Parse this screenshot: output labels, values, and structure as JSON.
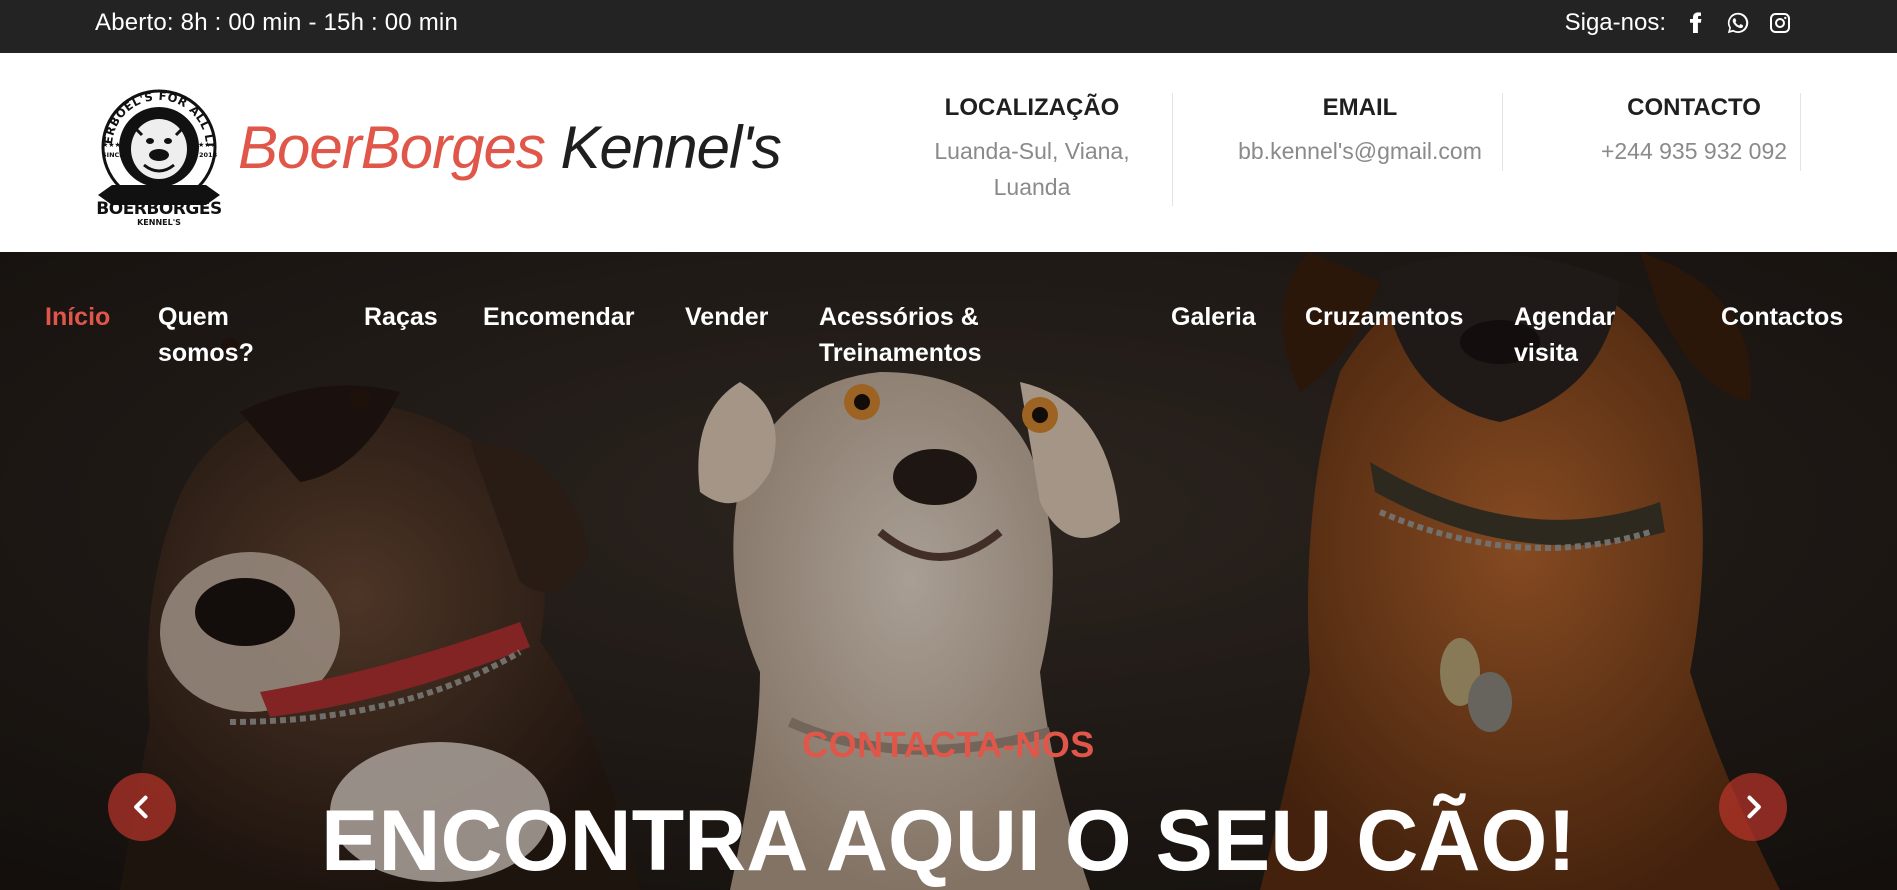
{
  "topbar": {
    "hours": "Aberto:  8h : 00 min - 15h : 00 min",
    "follow_label": "Siga-nos:",
    "social_icons": [
      "facebook-icon",
      "whatsapp-icon",
      "instagram-icon"
    ]
  },
  "header": {
    "logo": {
      "arc_top": "BOERBOEL'S FOR ALL LIFE",
      "since": "SINCE",
      "year": "2018",
      "name": "BOERBORGES",
      "sub": "KENNEL'S"
    },
    "brand_part1": "BoerBorges",
    "brand_part2": "Kennel's",
    "location": {
      "title": "LOCALIZAÇÃO",
      "line1": "Luanda-Sul, Viana,",
      "line2": "Luanda"
    },
    "email": {
      "title": "EMAIL",
      "value": "bb.kennel's@gmail.com"
    },
    "contact": {
      "title": "CONTACTO",
      "value": "+244 935 932 092"
    }
  },
  "nav": {
    "inicio": "Início",
    "quem_l1": "Quem",
    "quem_l2": "somos?",
    "racas": "Raças",
    "encomendar": "Encomendar",
    "vender": "Vender",
    "acess_l1": "Acessórios &",
    "acess_l2": "Treinamentos",
    "galeria": "Galeria",
    "cruzamentos": "Cruzamentos",
    "agendar_l1": "Agendar",
    "agendar_l2": "visita",
    "contactos": "Contactos"
  },
  "hero": {
    "kicker": "CONTACTA-NOS",
    "headline": "ENCONTRA AQUI O SEU CÃO!"
  },
  "colors": {
    "accent": "#e0574a",
    "topbar_bg": "#232323",
    "text_dark": "#1f1f1f",
    "text_muted": "#8a8a8a"
  }
}
